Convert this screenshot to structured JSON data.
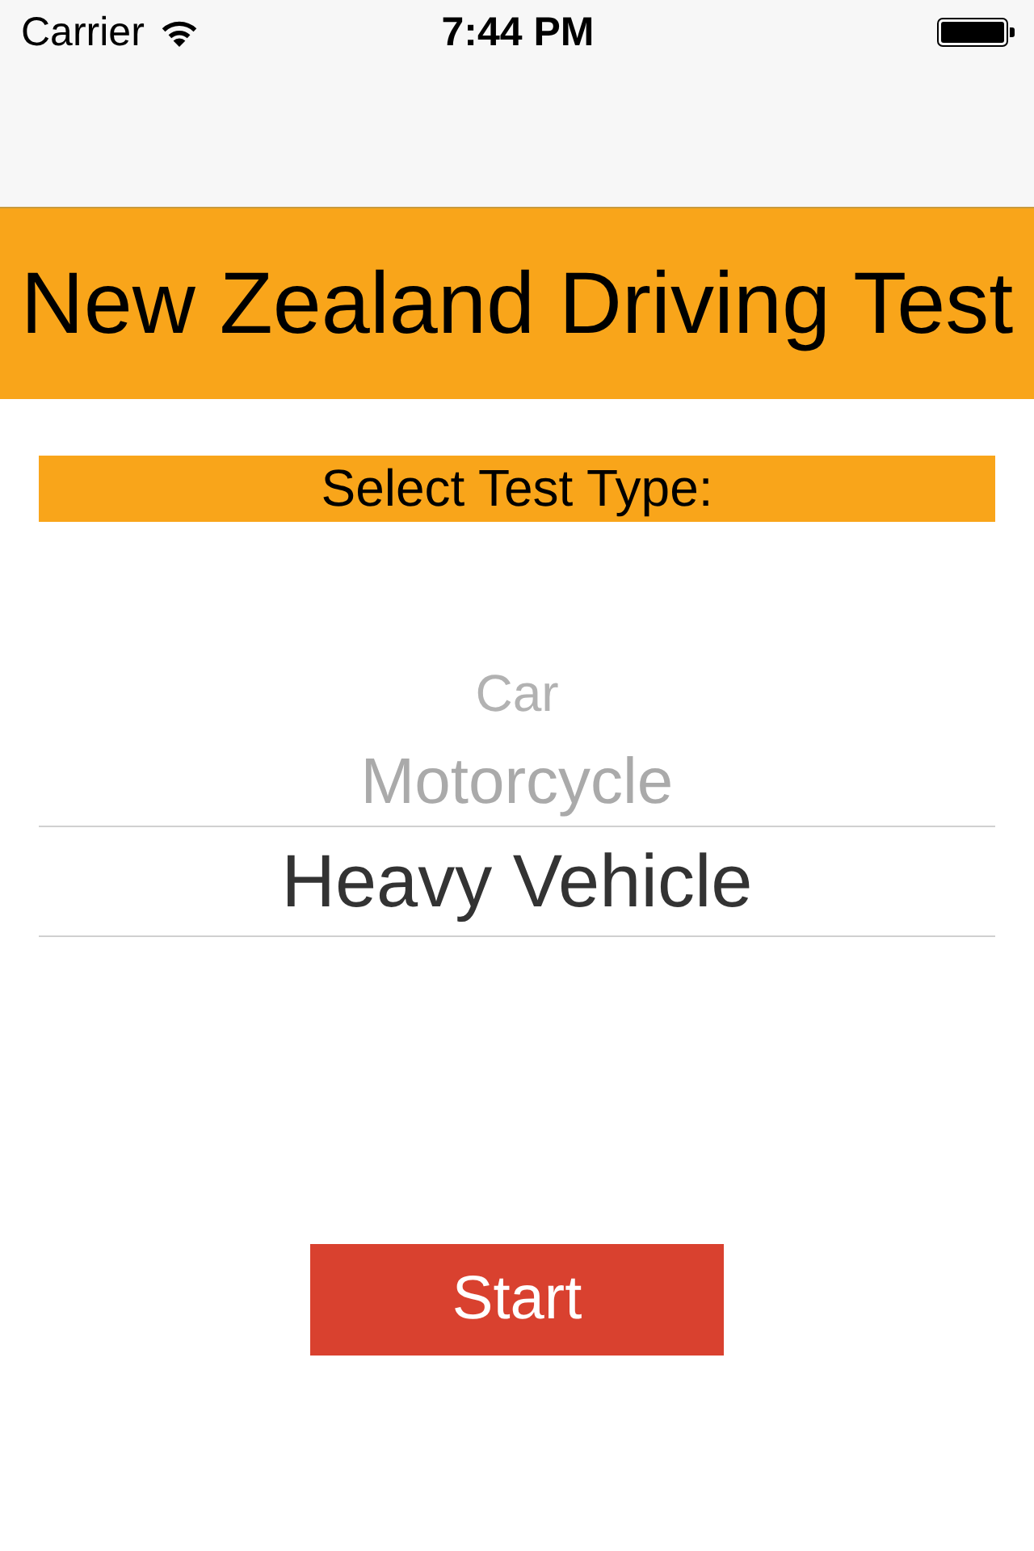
{
  "status_bar": {
    "carrier": "Carrier",
    "time": "7:44 PM"
  },
  "header": {
    "title": "New Zealand Driving Test"
  },
  "test_type": {
    "label": "Select Test Type:",
    "options": [
      {
        "label": "Car",
        "selected": false
      },
      {
        "label": "Motorcycle",
        "selected": false
      },
      {
        "label": "Heavy Vehicle",
        "selected": true
      }
    ]
  },
  "start_button": {
    "label": "Start"
  }
}
